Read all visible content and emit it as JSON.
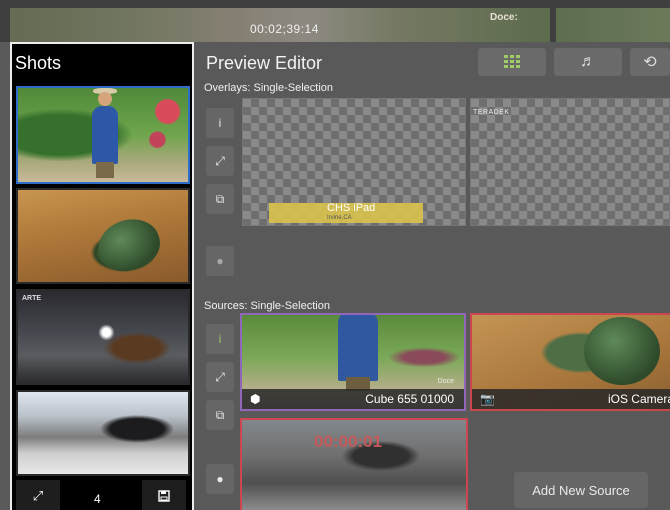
{
  "top_strip": {
    "timecode": "00:02;39:14",
    "logo": "Doce:"
  },
  "shots_panel": {
    "title": "Shots",
    "thumbnails": [
      {
        "name": "garden-speaker",
        "selected": true
      },
      {
        "name": "green-mouse",
        "selected": false
      },
      {
        "name": "dark-interview",
        "selected": false,
        "logo": "ARTE"
      },
      {
        "name": "office-keyboard",
        "selected": false
      }
    ],
    "count": "4",
    "buttons": {
      "expand_icon": "expand-icon",
      "save_icon": "save-icon"
    }
  },
  "editor": {
    "title": "Preview Editor",
    "toolbar": {
      "grid_icon": "grid-icon",
      "music_icon": "music-note-icon",
      "history_icon": "history-icon"
    },
    "overlays": {
      "label": "Overlays:  Single-Selection",
      "items": [
        {
          "title": "CHS iPad",
          "subtitle": "Irvine,CA"
        },
        {
          "brand": "TERADEK"
        }
      ]
    },
    "sources": {
      "label": "Sources:  Single-Selection",
      "items": [
        {
          "label": "Cube 655 01000",
          "icon": "cube-icon",
          "watermark": "Doce"
        },
        {
          "label": "iOS Camera",
          "icon": "camera-icon"
        },
        {
          "countdown": "00:00:01"
        }
      ],
      "add_label": "Add New Source"
    },
    "colors": {
      "selected_border": "#2f6ec8",
      "source_selected": "#8f66b8",
      "source_live": "#cc4650",
      "info_green": "#9ccc65"
    }
  }
}
